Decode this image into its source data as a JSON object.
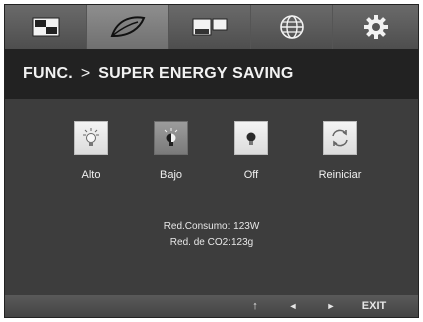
{
  "menu": {
    "tabs": [
      {
        "icon": "picture-icon",
        "active": false
      },
      {
        "icon": "leaf-eco-icon",
        "active": true
      },
      {
        "icon": "pip-screen-icon",
        "active": false
      },
      {
        "icon": "globe-icon",
        "active": false
      },
      {
        "icon": "gear-icon",
        "active": false
      }
    ]
  },
  "header": {
    "section": "FUNC.",
    "separator": ">",
    "page": "SUPER ENERGY SAVING"
  },
  "options": {
    "items": [
      {
        "label": "Alto",
        "icon": "bulb-high-icon",
        "selected": false
      },
      {
        "label": "Bajo",
        "icon": "bulb-low-icon",
        "selected": true
      },
      {
        "label": "Off",
        "icon": "bulb-off-icon",
        "selected": false
      },
      {
        "label": "Reiniciar",
        "icon": "reset-icon",
        "selected": false
      }
    ]
  },
  "info": {
    "consumption": "Red.Consumo: 123W",
    "co2": "Red. de CO2:123g"
  },
  "footer": {
    "up": "↑",
    "left": "◄",
    "right": "►",
    "exit": "EXIT"
  },
  "colors": {
    "background": "#3d3d3d",
    "title_bar": "#222222",
    "selected_option": "#8a8a8a"
  }
}
